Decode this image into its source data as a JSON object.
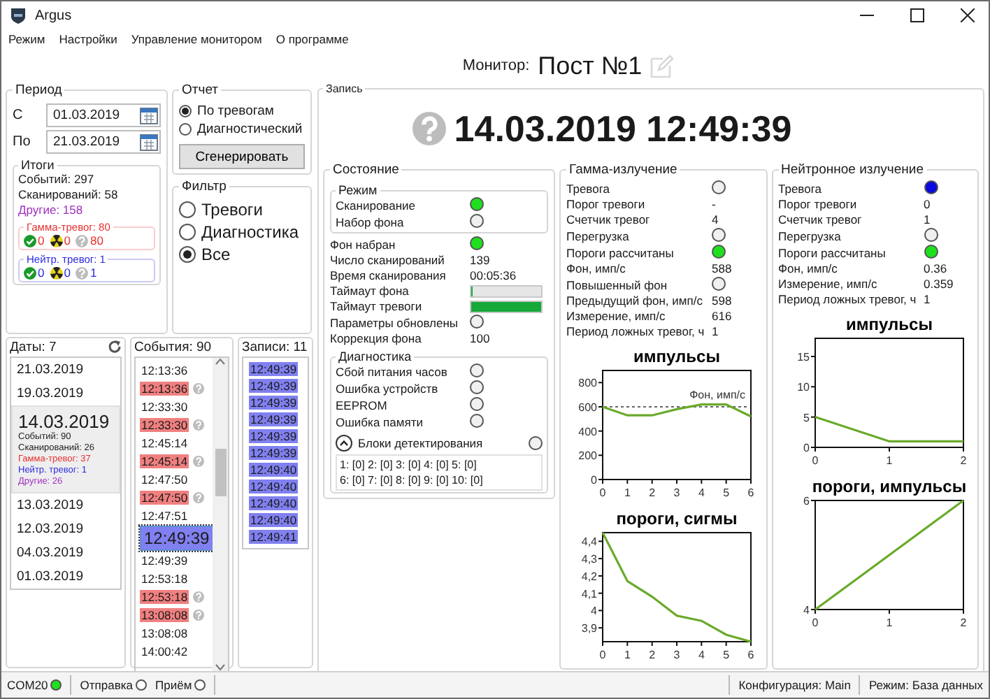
{
  "window": {
    "title": "Argus"
  },
  "menu": [
    "Режим",
    "Настройки",
    "Управление монитором",
    "О программе"
  ],
  "monitor": {
    "label": "Монитор:",
    "name": "Пост №1"
  },
  "period": {
    "title": "Период",
    "from_label": "С",
    "from": "01.03.2019",
    "to_label": "По",
    "to": "21.03.2019"
  },
  "totals": {
    "title": "Итоги",
    "events": "Событий: 297",
    "scans": "Сканирований: 58",
    "other": "Другие: 158",
    "groups": [
      {
        "title": "Гамма-тревог: 80",
        "color": "#e83030",
        "counts": [
          "0",
          "0",
          "80"
        ]
      },
      {
        "title": "Нейтр. тревог: 1",
        "color": "#2a2ae0",
        "counts": [
          "0",
          "0",
          "1"
        ]
      }
    ]
  },
  "report": {
    "title": "Отчет",
    "options": [
      {
        "label": "По тревогам",
        "selected": true
      },
      {
        "label": "Диагностический",
        "selected": false
      }
    ],
    "button": "Сгенерировать"
  },
  "filter": {
    "title": "Фильтр",
    "options": [
      {
        "label": "Тревоги",
        "selected": false
      },
      {
        "label": "Диагностика",
        "selected": false
      },
      {
        "label": "Все",
        "selected": true
      }
    ]
  },
  "dates": {
    "title": "Даты: 7",
    "items": [
      {
        "date": "21.03.2019",
        "selected": false
      },
      {
        "date": "19.03.2019",
        "selected": false
      },
      {
        "date": "14.03.2019",
        "selected": true,
        "details": [
          {
            "text": "Событий: 90",
            "color": "#202020"
          },
          {
            "text": "Сканирований: 26",
            "color": "#202020"
          },
          {
            "text": "Гамма-тревог: 37",
            "color": "#e83030"
          },
          {
            "text": "Нейтр. тревог: 1",
            "color": "#2a2ae0"
          },
          {
            "text": "Другие: 26",
            "color": "#a030c0"
          }
        ]
      },
      {
        "date": "13.03.2019",
        "selected": false
      },
      {
        "date": "12.03.2019",
        "selected": false
      },
      {
        "date": "04.03.2019",
        "selected": false
      },
      {
        "date": "01.03.2019",
        "selected": false
      }
    ]
  },
  "events": {
    "title": "События: 90",
    "items": [
      {
        "time": "12:13:36",
        "alarm": false,
        "selected": false
      },
      {
        "time": "12:13:36",
        "alarm": true,
        "selected": false
      },
      {
        "time": "12:33:30",
        "alarm": false,
        "selected": false
      },
      {
        "time": "12:33:30",
        "alarm": true,
        "selected": false
      },
      {
        "time": "12:45:14",
        "alarm": false,
        "selected": false
      },
      {
        "time": "12:45:14",
        "alarm": true,
        "selected": false
      },
      {
        "time": "12:47:50",
        "alarm": false,
        "selected": false
      },
      {
        "time": "12:47:50",
        "alarm": true,
        "selected": false
      },
      {
        "time": "12:47:51",
        "alarm": false,
        "selected": false
      },
      {
        "time": "12:49:39",
        "alarm": false,
        "selected": true
      },
      {
        "time": "12:49:39",
        "alarm": false,
        "selected": false
      },
      {
        "time": "12:53:18",
        "alarm": false,
        "selected": false
      },
      {
        "time": "12:53:18",
        "alarm": true,
        "selected": false
      },
      {
        "time": "13:08:08",
        "alarm": true,
        "selected": false
      },
      {
        "time": "13:08:08",
        "alarm": false,
        "selected": false
      },
      {
        "time": "14:00:42",
        "alarm": false,
        "selected": false
      }
    ]
  },
  "records": {
    "title": "Записи: 11",
    "items": [
      {
        "time": "12:49:39",
        "selected": true
      },
      {
        "time": "12:49:39",
        "selected": true
      },
      {
        "time": "12:49:39",
        "selected": true
      },
      {
        "time": "12:49:39",
        "selected": true
      },
      {
        "time": "12:49:39",
        "selected": true
      },
      {
        "time": "12:49:39",
        "selected": true
      },
      {
        "time": "12:49:40",
        "selected": true
      },
      {
        "time": "12:49:40",
        "selected": true
      },
      {
        "time": "12:49:40",
        "selected": true
      },
      {
        "time": "12:49:40",
        "selected": true
      },
      {
        "time": "12:49:41",
        "selected": true
      }
    ]
  },
  "record": {
    "title": "Запись",
    "datetime": "14.03.2019 12:49:39"
  },
  "state": {
    "title": "Состояние",
    "mode": {
      "title": "Режим",
      "rows": [
        {
          "kind": "indicator",
          "label": "Сканирование",
          "color": "#1ee01e"
        },
        {
          "kind": "indicator",
          "label": "Набор фона",
          "color": "#f0f0f0"
        }
      ]
    },
    "rows": [
      {
        "kind": "indicator",
        "label": "Фон набран",
        "color": "#1ee01e"
      },
      {
        "kind": "value",
        "label": "Число сканирований",
        "value": "139"
      },
      {
        "kind": "value",
        "label": "Время сканирования",
        "value": "00:05:36"
      },
      {
        "kind": "bar",
        "label": "Таймаут фона",
        "level": 0
      },
      {
        "kind": "bar",
        "label": "Таймаут тревоги",
        "level": 1
      },
      {
        "kind": "indicator",
        "label": "Параметры обновлены",
        "color": "#f0f0f0"
      },
      {
        "kind": "value",
        "label": "Коррекция фона",
        "value": "100"
      }
    ],
    "diagnostics": {
      "title": "Диагностика",
      "rows": [
        {
          "kind": "indicator",
          "label": "Сбой питания часов",
          "color": "#f0f0f0"
        },
        {
          "kind": "indicator",
          "label": "Ошибка устройств",
          "color": "#f0f0f0"
        },
        {
          "kind": "indicator",
          "label": "EEPROM",
          "color": "#f0f0f0"
        },
        {
          "kind": "indicator",
          "label": "Ошибка памяти",
          "color": "#f0f0f0"
        }
      ],
      "blocks": {
        "label": "Блоки детектирования",
        "expanded": true,
        "color": "#f0f0f0",
        "lines": [
          "1: [0] 2: [0] 3: [0] 4: [0] 5: [0]",
          "6: [0] 7: [0] 8: [0] 9: [0] 10: [0]"
        ]
      }
    }
  },
  "panels": [
    {
      "title": "Гамма-излучение",
      "rows": [
        {
          "kind": "indicator",
          "label": "Тревога",
          "color": "#f0f0f0"
        },
        {
          "kind": "value",
          "label": "Порог тревоги",
          "value": "-"
        },
        {
          "kind": "value",
          "label": "Счетчик тревог",
          "value": "4"
        },
        {
          "kind": "indicator",
          "label": "Перегрузка",
          "color": "#f0f0f0"
        },
        {
          "kind": "indicator",
          "label": "Пороги рассчитаны",
          "color": "#1ee01e"
        },
        {
          "kind": "value",
          "label": "Фон, имп/с",
          "value": "588"
        },
        {
          "kind": "indicator",
          "label": "Повышенный фон",
          "color": "#f0f0f0"
        },
        {
          "kind": "value",
          "label": "Предыдущий фон, имп/с",
          "value": "598"
        },
        {
          "kind": "value",
          "label": "Измерение, имп/с",
          "value": "616"
        },
        {
          "kind": "value",
          "label": "Период ложных тревог, ч",
          "value": "1"
        }
      ],
      "charts": [
        {
          "chart_data": {
            "type": "line",
            "title": "импульсы",
            "x": [
              0,
              1,
              2,
              3,
              4,
              5,
              6
            ],
            "series": [
              {
                "color": "#6aaa2a",
                "values": [
                  600,
                  530,
                  530,
                  580,
                  620,
                  620,
                  520
                ]
              }
            ],
            "xlim": [
              0,
              6
            ],
            "ylim": [
              0,
              900
            ],
            "xticks": [
              0,
              1,
              2,
              3,
              4,
              5,
              6
            ],
            "yticks": [
              0,
              200,
              400,
              600,
              800
            ],
            "ref_lines": [
              {
                "axis": "y",
                "value": 600,
                "label": "Фон, имп/с"
              }
            ]
          }
        },
        {
          "chart_data": {
            "type": "line",
            "title": "пороги, сигмы",
            "x": [
              0,
              1,
              2,
              3,
              4,
              5,
              6
            ],
            "series": [
              {
                "color": "#6aaa2a",
                "values": [
                  4.45,
                  4.17,
                  4.08,
                  3.97,
                  3.94,
                  3.86,
                  3.82
                ]
              }
            ],
            "xlim": [
              0,
              6
            ],
            "ylim": [
              3.82,
              4.45
            ],
            "xticks": [
              0,
              1,
              2,
              3,
              4,
              5,
              6
            ],
            "yticks": [
              {
                "value": 3.9,
                "label": "3,9"
              },
              {
                "value": 4,
                "label": "4"
              },
              {
                "value": 4.1,
                "label": "4,1"
              },
              {
                "value": 4.2,
                "label": "4,2"
              },
              {
                "value": 4.3,
                "label": "4,3"
              },
              {
                "value": 4.4,
                "label": "4,4"
              }
            ]
          }
        }
      ]
    },
    {
      "title": "Нейтронное излучение",
      "rows": [
        {
          "kind": "indicator",
          "label": "Тревога",
          "color": "#0a0ae0"
        },
        {
          "kind": "value",
          "label": "Порог тревоги",
          "value": "0"
        },
        {
          "kind": "value",
          "label": "Счетчик тревог",
          "value": "1"
        },
        {
          "kind": "indicator",
          "label": "Перегрузка",
          "color": "#f0f0f0"
        },
        {
          "kind": "indicator",
          "label": "Пороги рассчитаны",
          "color": "#1ee01e"
        },
        {
          "kind": "value",
          "label": "Фон, имп/с",
          "value": "0.36"
        },
        {
          "kind": "value",
          "label": "Измерение, имп/с",
          "value": "0.359"
        },
        {
          "kind": "value",
          "label": "Период ложных тревог, ч",
          "value": "1"
        }
      ],
      "charts": [
        {
          "chart_data": {
            "type": "line",
            "title": "импульсы",
            "x": [
              0,
              1,
              2
            ],
            "series": [
              {
                "color": "#6aaa2a",
                "values": [
                  5,
                  1,
                  1
                ]
              }
            ],
            "xlim": [
              0,
              2
            ],
            "ylim": [
              0,
              18
            ],
            "xticks": [
              0,
              1,
              2
            ],
            "yticks": [
              0,
              5,
              10,
              15
            ]
          }
        },
        {
          "chart_data": {
            "type": "line",
            "title": "пороги, импульсы",
            "x": [
              0,
              1,
              2
            ],
            "series": [
              {
                "color": "#6aaa2a",
                "values": [
                  4,
                  5,
                  6
                ]
              }
            ],
            "xlim": [
              0,
              2
            ],
            "ylim": [
              4,
              6
            ],
            "xticks": [
              0,
              1,
              2
            ],
            "yticks": [
              4,
              6
            ]
          }
        }
      ]
    }
  ],
  "status_bar": {
    "items": [
      {
        "label": "COM20",
        "color": "#1ee01e"
      },
      {
        "label": "Отправка",
        "color": "#ffffff"
      },
      {
        "label": "Приём",
        "color": "#ffffff"
      }
    ],
    "config": "Конфигурация: Main",
    "mode": "Режим: База данных"
  }
}
